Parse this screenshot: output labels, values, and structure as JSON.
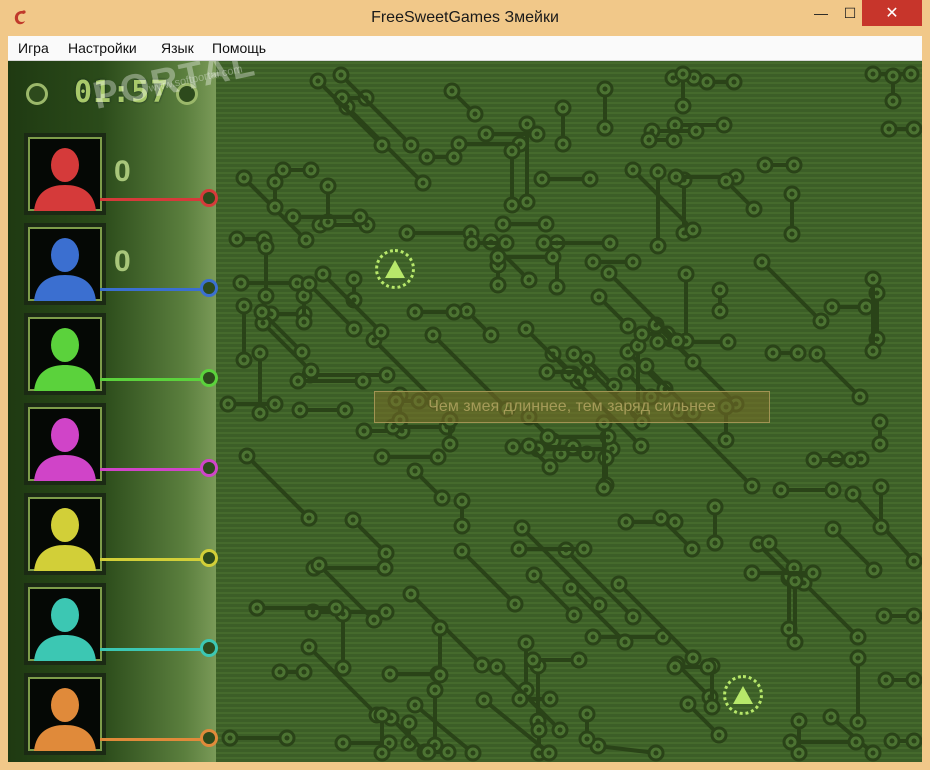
{
  "window": {
    "title": "FreeSweetGames Змейки",
    "minimize_glyph": "—",
    "maximize_glyph": "☐",
    "close_glyph": "✕"
  },
  "menu": {
    "items": [
      {
        "label": "Игра"
      },
      {
        "label": "Настройки"
      },
      {
        "label": "Язык"
      },
      {
        "label": "Помощь"
      }
    ]
  },
  "timer": {
    "value": "01:57"
  },
  "watermark": {
    "text": "PORTAL",
    "sub": "www.softportal.com"
  },
  "players": [
    {
      "color": "#d53a3a",
      "score": "0"
    },
    {
      "color": "#3b6fd0",
      "score": "0"
    },
    {
      "color": "#5bd23c",
      "score": ""
    },
    {
      "color": "#d044c8",
      "score": ""
    },
    {
      "color": "#d2cf38",
      "score": ""
    },
    {
      "color": "#3cc7b3",
      "score": ""
    },
    {
      "color": "#e08a3a",
      "score": ""
    }
  ],
  "hint": {
    "text": "Чем змея длиннее, тем заряд сильнее"
  },
  "colors": {
    "board": "#3c5e27",
    "trace": "#2a4318",
    "accent": "#b7e86a"
  }
}
